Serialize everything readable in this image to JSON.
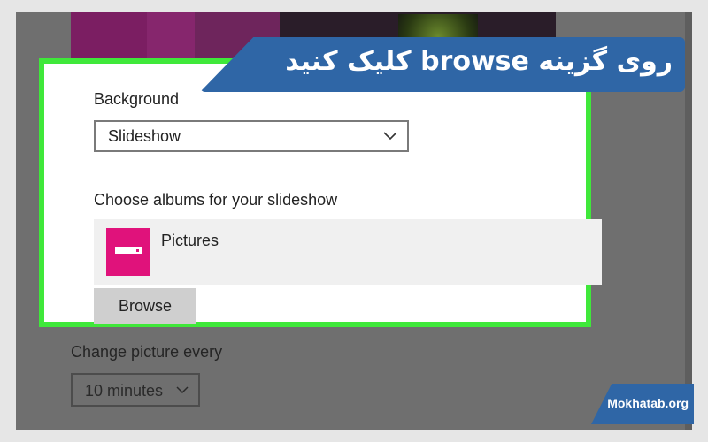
{
  "banner": {
    "text": "روی گزینه browse کلیک کنید"
  },
  "background_section": {
    "label": "Background",
    "dropdown_value": "Slideshow"
  },
  "albums_section": {
    "label": "Choose albums for your slideshow",
    "album_name": "Pictures",
    "browse_label": "Browse"
  },
  "change_picture": {
    "label": "Change picture every",
    "value": "10 minutes"
  },
  "watermark": {
    "text": "Mokhatab.org"
  },
  "colors": {
    "highlight": "#3fe83a",
    "banner": "#2f66a6",
    "album_tile": "#e0127b"
  }
}
